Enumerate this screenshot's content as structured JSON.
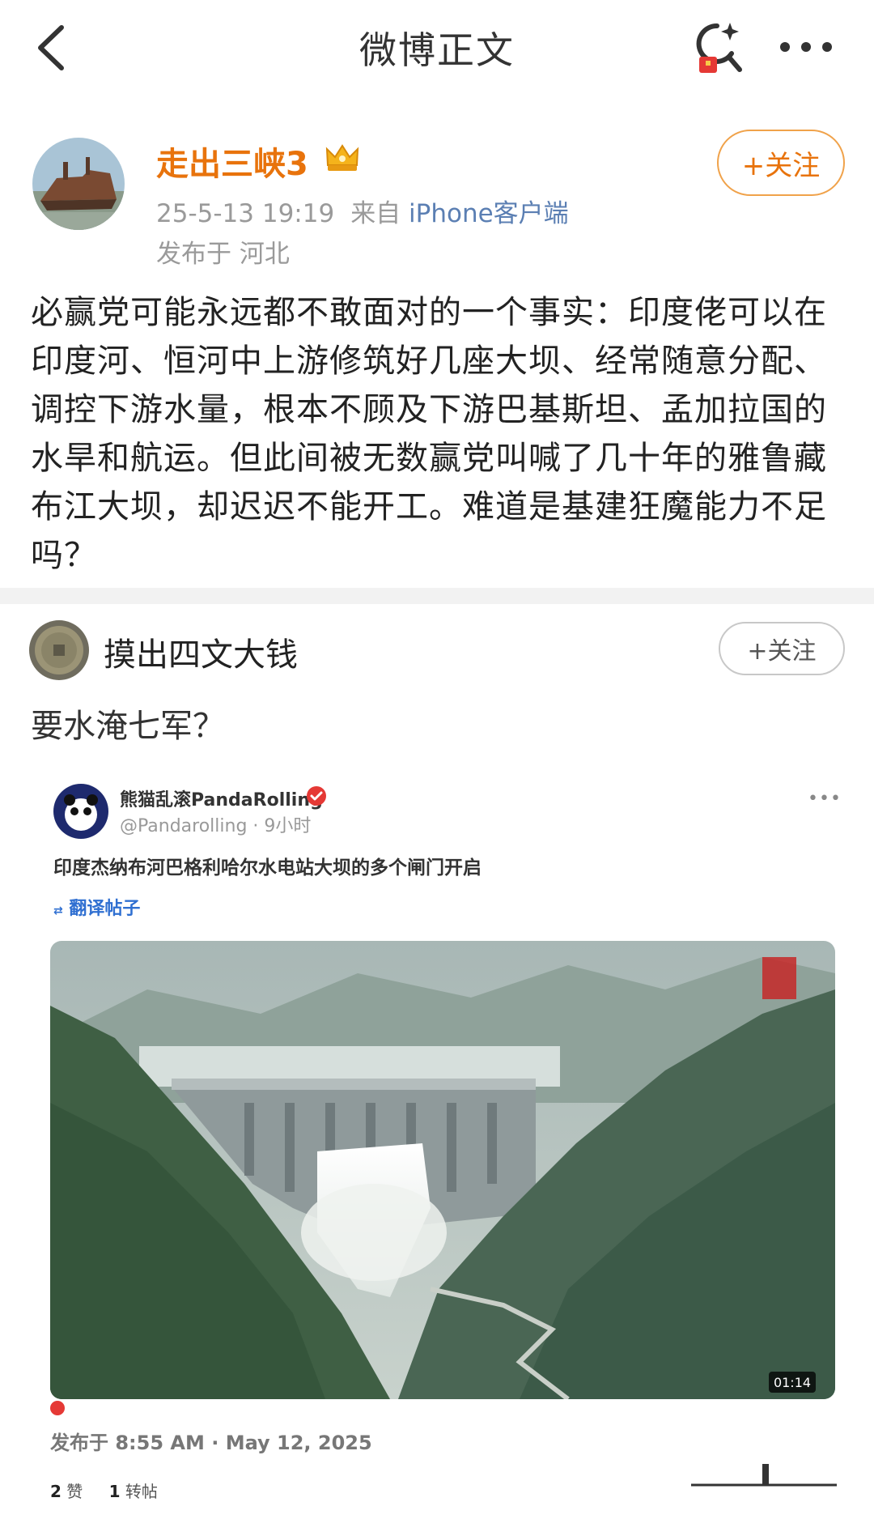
{
  "nav": {
    "title": "微博正文"
  },
  "post": {
    "author": "走出三峡3",
    "time": "25-5-13 19:19",
    "source_prefix": "来自",
    "source": "iPhone客户端",
    "location": "发布于 河北",
    "follow_label": "+关注",
    "body": "必赢党可能永远都不敢面对的一个事实：印度佬可以在印度河、恒河中上游修筑好几座大坝、经常随意分配、调控下游水量，根本不顾及下游巴基斯坦、孟加拉国的水旱和航运。但此间被无数赢党叫喊了几十年的雅鲁藏布江大坝，却迟迟不能开工。难道是基建狂魔能力不足吗？"
  },
  "comment": {
    "author": "摸出四文大钱",
    "follow_label": "+关注",
    "text": "要水淹七军？"
  },
  "embed": {
    "name": "熊猫乱滚PandaRolling",
    "handle": "@Pandarolling · 9小时",
    "text": "印度杰纳布河巴格利哈尔水电站大坝的多个闸门开启",
    "translate_label": "翻译帖子",
    "video_duration": "01:14",
    "date": "发布于 8:55 AM · May 12, 2025",
    "likes_count": "2",
    "likes_label": "赞",
    "reposts_count": "1",
    "reposts_label": "转帖"
  },
  "colors": {
    "author_orange": "#e8730c",
    "link_blue": "#5b7fb3",
    "divider_gray": "#f2f2f2"
  }
}
